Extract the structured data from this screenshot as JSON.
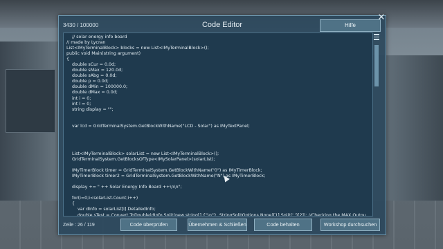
{
  "editor": {
    "title": "Code Editor",
    "char_counter": "3430 / 100000",
    "help_label": "Hilfe",
    "close_symbol": "✕",
    "line_info": "Zeile : 26 / 119"
  },
  "code_lines": [
    "    // solar energy info board",
    "// made by Lycran",
    "List<IMyTerminalBlock> blocks = new List<IMyTerminalBlock>();",
    "public void Main(string argument)",
    "{",
    "    double sCur = 0.0d;",
    "    double sMax = 120.0d;",
    "    double sAbg = 0.0d;",
    "    double p = 0.0d;",
    "    double dMin = 100000.0;",
    "    double dMax = 0.0d;",
    "    int i = 0;",
    "    int l = 0;",
    "    string display = \"\";",
    "",
    "",
    "    var lcd = GridTerminalSystem.GetBlockWithName(\"LCD - Solar\") as IMyTextPanel;",
    "",
    "",
    "",
    "",
    "    List<IMyTerminalBlock> solarList = new List<IMyTerminalBlock>();",
    "    GridTerminalSystem.GetBlocksOfType<IMySolarPanel>(solarList);",
    "",
    "    IMyTimerBlock timer = GridTerminalSystem.GetBlockWithName(\"0\") as IMyTimerBlock;",
    "    IMyTimerBlock timer2 = GridTerminalSystem.GetBlockWithName(\"N\") as IMyTimerBlock;",
    "",
    "    display += \" ++ Solar Energy Info Board ++\\n\\n\";",
    "",
    "    for(i=0;i<solarList.Count;i++)",
    "    {",
    "        var dInfo = solarList[i].DetailedInfo;",
    "        double sTest = Convert.ToDouble(dInfo.Split(new string[] {\"\\n\"}, StringSplitOptions.None)[1].Split(' ')[2]); //Checking the MAX Outpu"
  ],
  "buttons": {
    "check": "Code überprüfen",
    "apply_close": "Übernehmen & Schließen",
    "keep": "Code behalten",
    "workshop": "Workshop durchsuchen"
  }
}
